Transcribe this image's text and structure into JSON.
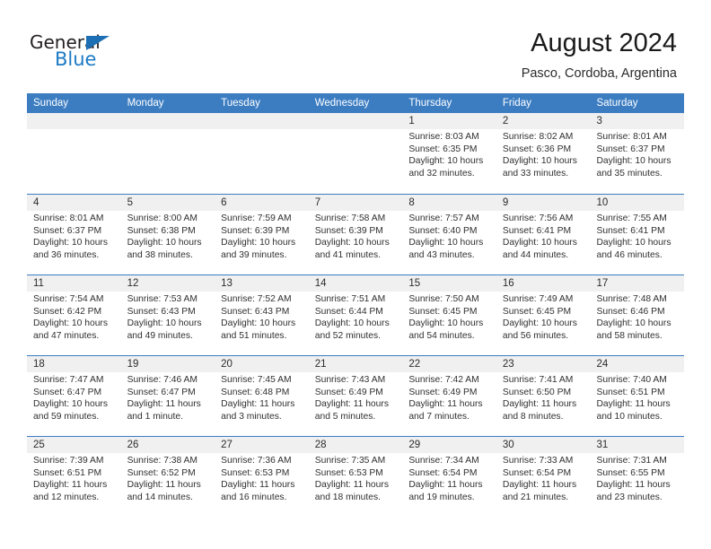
{
  "brand": {
    "name_dark": "General",
    "name_light": "Blue",
    "triangle_color": "#1c6fb4",
    "blue_color": "#1c7ac4"
  },
  "header": {
    "title": "August 2024",
    "location": "Pasco, Cordoba, Argentina"
  },
  "theme": {
    "header_blue": "#3c7dc2",
    "num_band_gray": "#f0f0f0",
    "text_color": "#303030"
  },
  "weekdays": [
    "Sunday",
    "Monday",
    "Tuesday",
    "Wednesday",
    "Thursday",
    "Friday",
    "Saturday"
  ],
  "weeks": [
    [
      {
        "day": "",
        "lines": []
      },
      {
        "day": "",
        "lines": []
      },
      {
        "day": "",
        "lines": []
      },
      {
        "day": "",
        "lines": []
      },
      {
        "day": "1",
        "lines": [
          "Sunrise: 8:03 AM",
          "Sunset: 6:35 PM",
          "Daylight: 10 hours",
          "and 32 minutes."
        ]
      },
      {
        "day": "2",
        "lines": [
          "Sunrise: 8:02 AM",
          "Sunset: 6:36 PM",
          "Daylight: 10 hours",
          "and 33 minutes."
        ]
      },
      {
        "day": "3",
        "lines": [
          "Sunrise: 8:01 AM",
          "Sunset: 6:37 PM",
          "Daylight: 10 hours",
          "and 35 minutes."
        ]
      }
    ],
    [
      {
        "day": "4",
        "lines": [
          "Sunrise: 8:01 AM",
          "Sunset: 6:37 PM",
          "Daylight: 10 hours",
          "and 36 minutes."
        ]
      },
      {
        "day": "5",
        "lines": [
          "Sunrise: 8:00 AM",
          "Sunset: 6:38 PM",
          "Daylight: 10 hours",
          "and 38 minutes."
        ]
      },
      {
        "day": "6",
        "lines": [
          "Sunrise: 7:59 AM",
          "Sunset: 6:39 PM",
          "Daylight: 10 hours",
          "and 39 minutes."
        ]
      },
      {
        "day": "7",
        "lines": [
          "Sunrise: 7:58 AM",
          "Sunset: 6:39 PM",
          "Daylight: 10 hours",
          "and 41 minutes."
        ]
      },
      {
        "day": "8",
        "lines": [
          "Sunrise: 7:57 AM",
          "Sunset: 6:40 PM",
          "Daylight: 10 hours",
          "and 43 minutes."
        ]
      },
      {
        "day": "9",
        "lines": [
          "Sunrise: 7:56 AM",
          "Sunset: 6:41 PM",
          "Daylight: 10 hours",
          "and 44 minutes."
        ]
      },
      {
        "day": "10",
        "lines": [
          "Sunrise: 7:55 AM",
          "Sunset: 6:41 PM",
          "Daylight: 10 hours",
          "and 46 minutes."
        ]
      }
    ],
    [
      {
        "day": "11",
        "lines": [
          "Sunrise: 7:54 AM",
          "Sunset: 6:42 PM",
          "Daylight: 10 hours",
          "and 47 minutes."
        ]
      },
      {
        "day": "12",
        "lines": [
          "Sunrise: 7:53 AM",
          "Sunset: 6:43 PM",
          "Daylight: 10 hours",
          "and 49 minutes."
        ]
      },
      {
        "day": "13",
        "lines": [
          "Sunrise: 7:52 AM",
          "Sunset: 6:43 PM",
          "Daylight: 10 hours",
          "and 51 minutes."
        ]
      },
      {
        "day": "14",
        "lines": [
          "Sunrise: 7:51 AM",
          "Sunset: 6:44 PM",
          "Daylight: 10 hours",
          "and 52 minutes."
        ]
      },
      {
        "day": "15",
        "lines": [
          "Sunrise: 7:50 AM",
          "Sunset: 6:45 PM",
          "Daylight: 10 hours",
          "and 54 minutes."
        ]
      },
      {
        "day": "16",
        "lines": [
          "Sunrise: 7:49 AM",
          "Sunset: 6:45 PM",
          "Daylight: 10 hours",
          "and 56 minutes."
        ]
      },
      {
        "day": "17",
        "lines": [
          "Sunrise: 7:48 AM",
          "Sunset: 6:46 PM",
          "Daylight: 10 hours",
          "and 58 minutes."
        ]
      }
    ],
    [
      {
        "day": "18",
        "lines": [
          "Sunrise: 7:47 AM",
          "Sunset: 6:47 PM",
          "Daylight: 10 hours",
          "and 59 minutes."
        ]
      },
      {
        "day": "19",
        "lines": [
          "Sunrise: 7:46 AM",
          "Sunset: 6:47 PM",
          "Daylight: 11 hours",
          "and 1 minute."
        ]
      },
      {
        "day": "20",
        "lines": [
          "Sunrise: 7:45 AM",
          "Sunset: 6:48 PM",
          "Daylight: 11 hours",
          "and 3 minutes."
        ]
      },
      {
        "day": "21",
        "lines": [
          "Sunrise: 7:43 AM",
          "Sunset: 6:49 PM",
          "Daylight: 11 hours",
          "and 5 minutes."
        ]
      },
      {
        "day": "22",
        "lines": [
          "Sunrise: 7:42 AM",
          "Sunset: 6:49 PM",
          "Daylight: 11 hours",
          "and 7 minutes."
        ]
      },
      {
        "day": "23",
        "lines": [
          "Sunrise: 7:41 AM",
          "Sunset: 6:50 PM",
          "Daylight: 11 hours",
          "and 8 minutes."
        ]
      },
      {
        "day": "24",
        "lines": [
          "Sunrise: 7:40 AM",
          "Sunset: 6:51 PM",
          "Daylight: 11 hours",
          "and 10 minutes."
        ]
      }
    ],
    [
      {
        "day": "25",
        "lines": [
          "Sunrise: 7:39 AM",
          "Sunset: 6:51 PM",
          "Daylight: 11 hours",
          "and 12 minutes."
        ]
      },
      {
        "day": "26",
        "lines": [
          "Sunrise: 7:38 AM",
          "Sunset: 6:52 PM",
          "Daylight: 11 hours",
          "and 14 minutes."
        ]
      },
      {
        "day": "27",
        "lines": [
          "Sunrise: 7:36 AM",
          "Sunset: 6:53 PM",
          "Daylight: 11 hours",
          "and 16 minutes."
        ]
      },
      {
        "day": "28",
        "lines": [
          "Sunrise: 7:35 AM",
          "Sunset: 6:53 PM",
          "Daylight: 11 hours",
          "and 18 minutes."
        ]
      },
      {
        "day": "29",
        "lines": [
          "Sunrise: 7:34 AM",
          "Sunset: 6:54 PM",
          "Daylight: 11 hours",
          "and 19 minutes."
        ]
      },
      {
        "day": "30",
        "lines": [
          "Sunrise: 7:33 AM",
          "Sunset: 6:54 PM",
          "Daylight: 11 hours",
          "and 21 minutes."
        ]
      },
      {
        "day": "31",
        "lines": [
          "Sunrise: 7:31 AM",
          "Sunset: 6:55 PM",
          "Daylight: 11 hours",
          "and 23 minutes."
        ]
      }
    ]
  ]
}
